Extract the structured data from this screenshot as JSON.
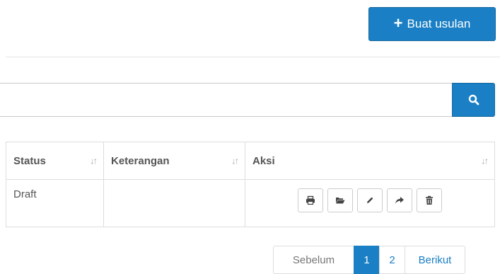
{
  "toolbar": {
    "create_label": "Buat usulan"
  },
  "search": {
    "value": "",
    "placeholder": ""
  },
  "table": {
    "columns": [
      "Status",
      "Keterangan",
      "Aksi"
    ],
    "rows": [
      {
        "status": "Draft",
        "keterangan": ""
      }
    ]
  },
  "pagination": {
    "prev_label": "Sebelum",
    "pages": [
      "1",
      "2"
    ],
    "active_page": "1",
    "next_label": "Berikut"
  },
  "icons": {
    "create": "plus-icon",
    "search": "search-icon",
    "sort": "sort-icon",
    "actions": [
      "print-icon",
      "folder-open-icon",
      "pencil-icon",
      "share-icon",
      "trash-icon"
    ]
  },
  "colors": {
    "primary": "#1a7fc4",
    "border": "#dddddd"
  }
}
